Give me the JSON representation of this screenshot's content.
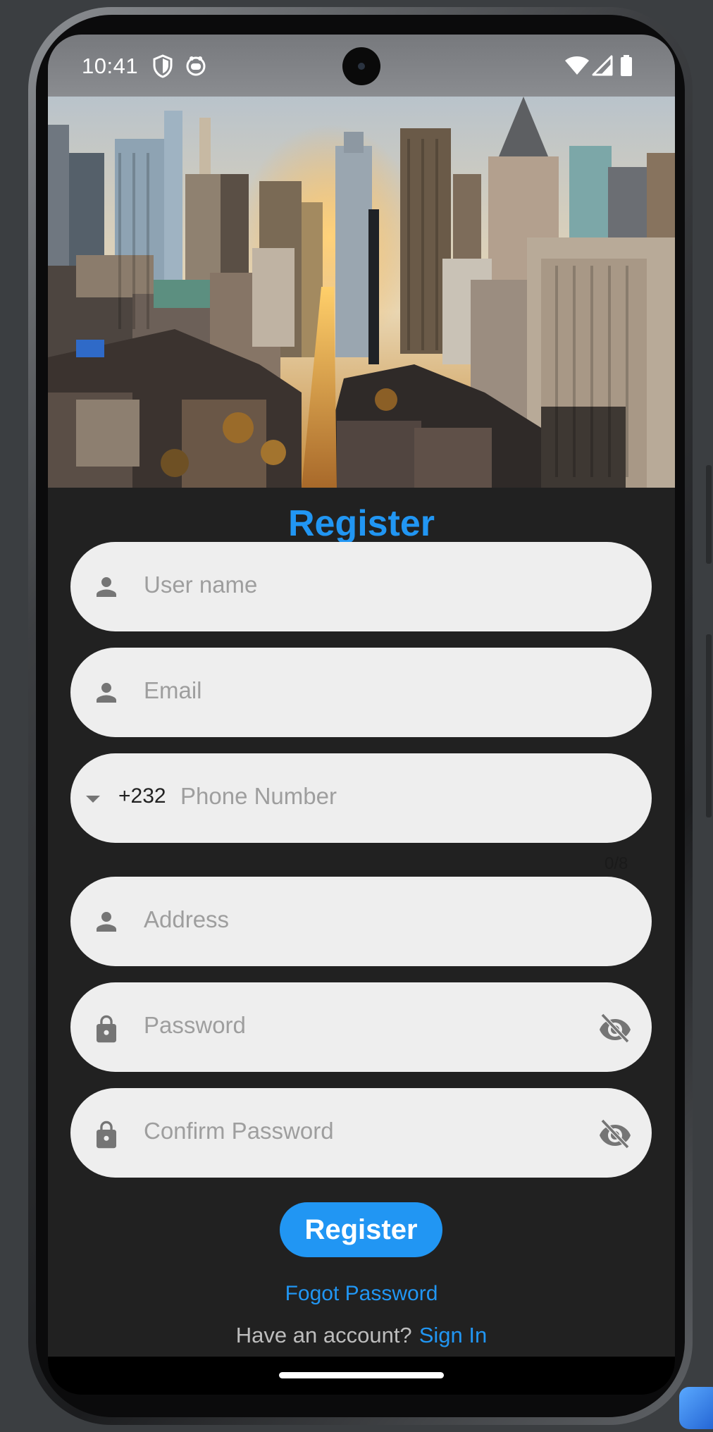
{
  "status_bar": {
    "time": "10:41"
  },
  "page": {
    "title": "Register"
  },
  "form": {
    "username": {
      "placeholder": "User name",
      "icon": "person-icon"
    },
    "email": {
      "placeholder": "Email",
      "icon": "person-icon"
    },
    "phone": {
      "country_code": "+232",
      "placeholder": "Phone Number",
      "counter": "0/8"
    },
    "address": {
      "placeholder": "Address",
      "icon": "person-icon"
    },
    "password": {
      "placeholder": "Password",
      "icon": "lock-icon",
      "toggle_icon": "visibility-off-icon"
    },
    "confirm_password": {
      "placeholder": "Confirm Password",
      "icon": "lock-icon",
      "toggle_icon": "visibility-off-icon"
    }
  },
  "actions": {
    "register_label": "Register",
    "forgot_label": "Fogot Password",
    "have_account_label": "Have an account?",
    "sign_in_label": "Sign In"
  },
  "colors": {
    "accent": "#2196f3",
    "background": "#212121",
    "field_background": "#eeeeee",
    "placeholder": "#9e9e9e"
  }
}
